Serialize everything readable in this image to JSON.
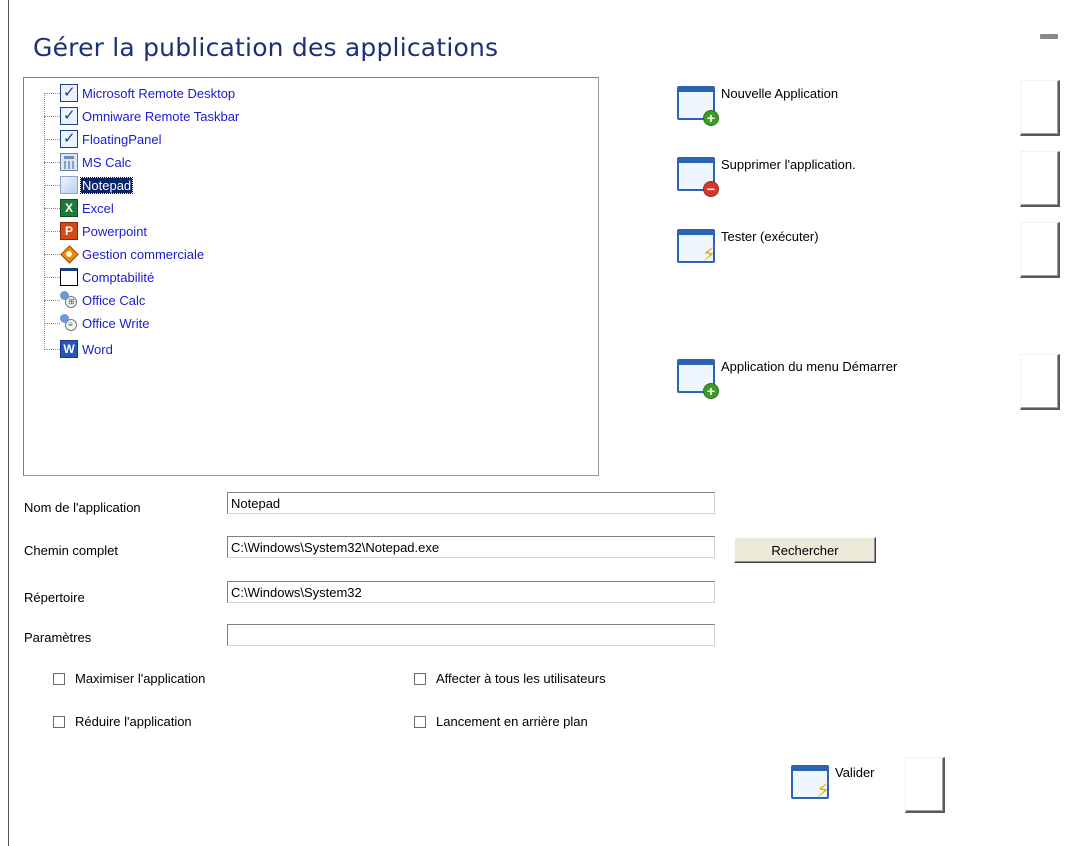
{
  "title": "Gérer la publication des applications",
  "tree": {
    "items": [
      {
        "label": "Microsoft Remote Desktop",
        "icon": "checkbox-window-icon",
        "selected": false
      },
      {
        "label": "Omniware Remote Taskbar",
        "icon": "checkbox-window-icon",
        "selected": false
      },
      {
        "label": "FloatingPanel",
        "icon": "checkbox-window-icon",
        "selected": false
      },
      {
        "label": "MS Calc",
        "icon": "calculator-icon",
        "selected": false
      },
      {
        "label": "Notepad",
        "icon": "notepad-icon",
        "selected": true
      },
      {
        "label": "Excel",
        "icon": "excel-icon",
        "selected": false
      },
      {
        "label": "Powerpoint",
        "icon": "powerpoint-icon",
        "selected": false
      },
      {
        "label": "Gestion commerciale",
        "icon": "gestion-icon",
        "selected": false
      },
      {
        "label": "Comptabilité",
        "icon": "window-icon",
        "selected": false
      },
      {
        "label": "Office Calc",
        "icon": "office-calc-icon",
        "selected": false
      },
      {
        "label": "Office Write",
        "icon": "office-write-icon",
        "selected": false
      },
      {
        "label": "Word",
        "icon": "word-icon",
        "selected": false
      }
    ]
  },
  "actions": {
    "new_app": "Nouvelle Application",
    "delete_app": "Supprimer l'application.",
    "test_app": "Tester (exécuter)",
    "start_menu_app": "Application du menu Démarrer",
    "validate": "Valider"
  },
  "form": {
    "name_label": "Nom de l'application",
    "name_value": "Notepad",
    "path_label": "Chemin complet",
    "path_value": "C:\\Windows\\System32\\Notepad.exe",
    "dir_label": "Répertoire",
    "dir_value": "C:\\Windows\\System32",
    "params_label": "Paramètres",
    "params_value": "",
    "search_button": "Rechercher"
  },
  "options": {
    "maximize": "Maximiser l'application",
    "assign_all": "Affecter à tous les utilisateurs",
    "reduce": "Réduire l'application",
    "background": "Lancement en arrière plan"
  },
  "colors": {
    "title": "#1e2f7a",
    "tree_link": "#1b1bd0",
    "selection": "#0a246a",
    "window_blue": "#2b63b5",
    "plus_green": "#3a9b25",
    "minus_red": "#d13a2a"
  }
}
